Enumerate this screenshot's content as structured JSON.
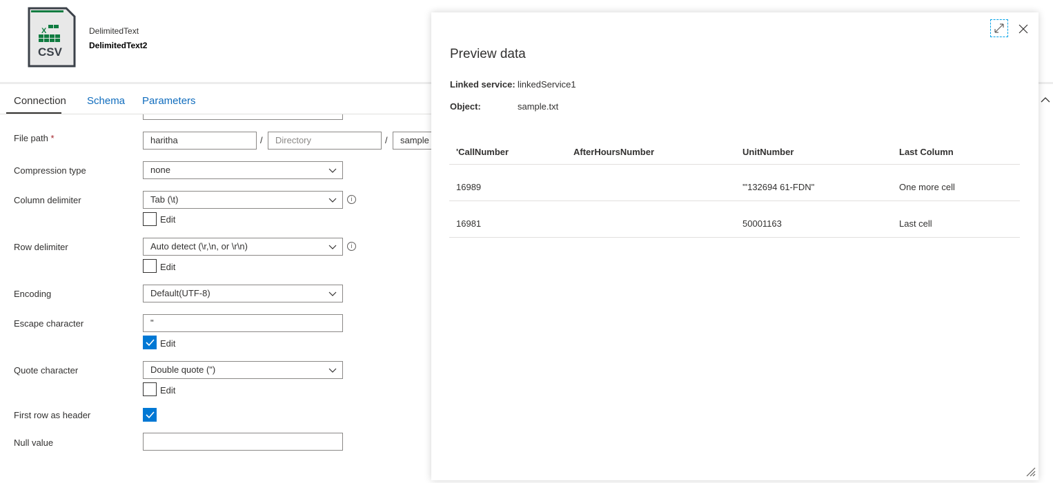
{
  "header": {
    "type": "DelimitedText",
    "name": "DelimitedText2",
    "icon": "csv-file-icon",
    "icon_text": "CSV"
  },
  "tabs": [
    {
      "label": "Connection",
      "active": true
    },
    {
      "label": "Schema"
    },
    {
      "label": "Parameters"
    }
  ],
  "form": {
    "file_path": {
      "label": "File path",
      "required_mark": "*",
      "container": "haritha",
      "directory_placeholder": "Directory",
      "file": "sample"
    },
    "compression_type": {
      "label": "Compression type",
      "value": "none"
    },
    "column_delimiter": {
      "label": "Column delimiter",
      "value": "Tab (\\t)",
      "edit_label": "Edit",
      "edit_checked": false
    },
    "row_delimiter": {
      "label": "Row delimiter",
      "value": "Auto detect (\\r,\\n, or \\r\\n)",
      "edit_label": "Edit",
      "edit_checked": false
    },
    "encoding": {
      "label": "Encoding",
      "value": "Default(UTF-8)"
    },
    "escape_character": {
      "label": "Escape character",
      "value": "\"",
      "edit_label": "Edit",
      "edit_checked": true
    },
    "quote_character": {
      "label": "Quote character",
      "value": "Double quote (\")",
      "edit_label": "Edit",
      "edit_checked": false
    },
    "first_row_header": {
      "label": "First row as header",
      "checked": true
    },
    "null_value": {
      "label": "Null value",
      "value": ""
    }
  },
  "preview": {
    "title": "Preview data",
    "linked_service_label": "Linked service:",
    "linked_service": "linkedService1",
    "object_label": "Object:",
    "object": "sample.txt",
    "columns": [
      "'CallNumber",
      "AfterHoursNumber",
      "UnitNumber",
      "Last Column"
    ],
    "rows": [
      [
        "16989",
        "",
        "'\"132694 61-FDN\"",
        "One more cell"
      ],
      [
        "16981",
        "",
        "50001163",
        "Last cell"
      ]
    ]
  },
  "colors": {
    "accent": "#0078d4",
    "link": "#0f6cbd",
    "excel_green": "#107c41"
  }
}
